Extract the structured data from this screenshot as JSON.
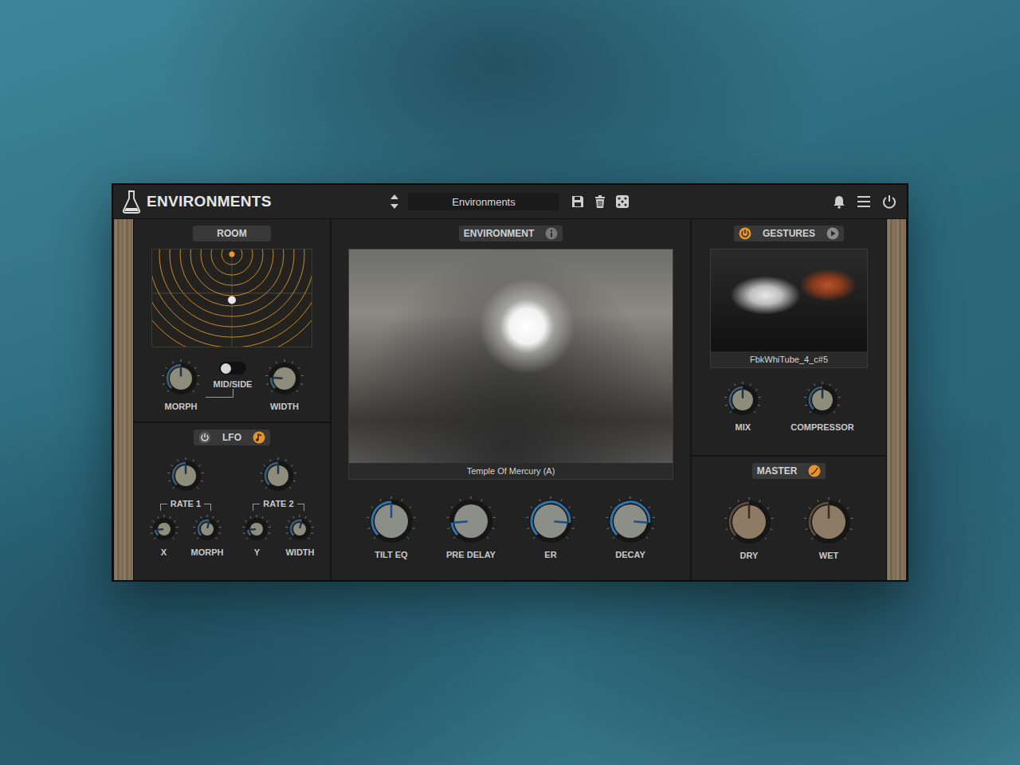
{
  "plugin": {
    "title": "ENVIRONMENTS"
  },
  "preset": {
    "name": "Environments"
  },
  "room": {
    "label": "ROOM",
    "source": {
      "x": 0.5,
      "y": 0.05
    },
    "puck": {
      "x": 0.5,
      "y": 0.52
    },
    "mid_side": {
      "label": "MID/SIDE",
      "on": false
    },
    "knobs": [
      {
        "label": "MORPH",
        "level": 0.5
      },
      {
        "label": "WIDTH",
        "level": 0.18
      }
    ]
  },
  "lfo": {
    "label": "LFO",
    "on": false,
    "sync": true,
    "rates": [
      {
        "label": "RATE 1",
        "level": 0.5,
        "knobs": [
          {
            "label": "X",
            "level": 0.15
          },
          {
            "label": "MORPH",
            "level": 0.55
          }
        ]
      },
      {
        "label": "RATE 2",
        "level": 0.5,
        "knobs": [
          {
            "label": "Y",
            "level": 0.15
          },
          {
            "label": "WIDTH",
            "level": 0.55
          }
        ]
      }
    ]
  },
  "environment": {
    "label": "ENVIRONMENT",
    "caption": "Temple Of Mercury (A)",
    "knobs": [
      {
        "label": "TILT EQ",
        "level": 0.5
      },
      {
        "label": "PRE DELAY",
        "level": 0.15
      },
      {
        "label": "ER",
        "level": 0.85
      },
      {
        "label": "DECAY",
        "level": 0.85
      }
    ]
  },
  "gestures": {
    "label": "GESTURES",
    "on": true,
    "caption": "FbkWhiTube_4_c#5",
    "knobs": [
      {
        "label": "MIX",
        "level": 0.5
      },
      {
        "label": "COMPRESSOR",
        "level": 0.5
      }
    ]
  },
  "master": {
    "label": "MASTER",
    "curve_on": true,
    "knobs": [
      {
        "label": "DRY",
        "level": 0.5
      },
      {
        "label": "WET",
        "level": 0.5
      }
    ]
  }
}
